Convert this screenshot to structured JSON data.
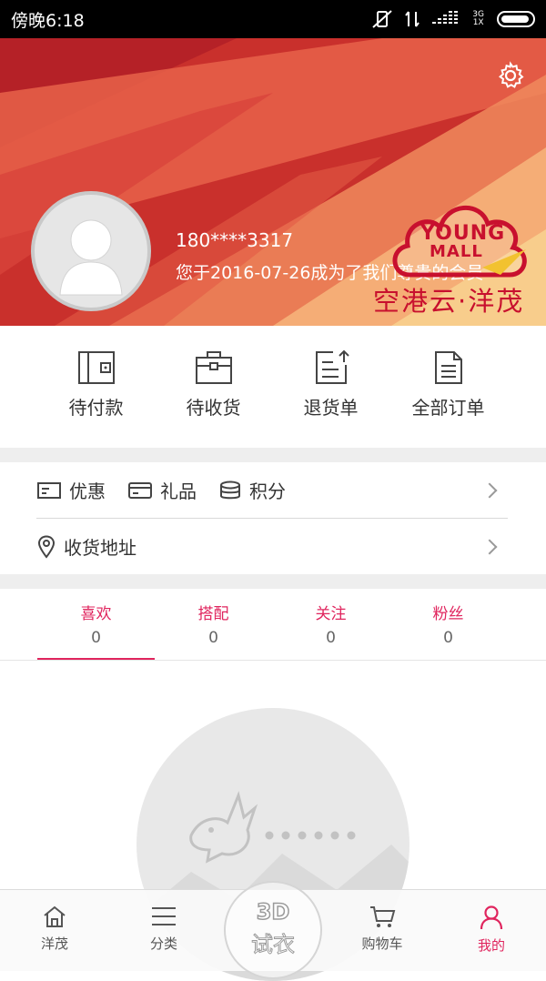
{
  "status_bar": {
    "time": "傍晚6:18",
    "network": "3G",
    "network_sub": "1X"
  },
  "profile": {
    "phone": "180****3317",
    "member_since": "您于2016-07-26成为了我们尊贵的会员"
  },
  "brand": {
    "logo_en_1": "YOUNG",
    "logo_en_2": "MALL",
    "logo_cn": "空港云·洋茂"
  },
  "orders": [
    {
      "label": "待付款",
      "icon": "wallet-icon"
    },
    {
      "label": "待收货",
      "icon": "briefcase-icon"
    },
    {
      "label": "退货单",
      "icon": "return-document-icon"
    },
    {
      "label": "全部订单",
      "icon": "document-icon"
    }
  ],
  "assets": [
    {
      "label": "优惠",
      "icon": "coupon-icon"
    },
    {
      "label": "礼品",
      "icon": "gift-card-icon"
    },
    {
      "label": "积分",
      "icon": "coins-icon"
    }
  ],
  "address": {
    "label": "收货地址",
    "icon": "location-pin-icon"
  },
  "social_tabs": [
    {
      "label": "喜欢",
      "count": "0",
      "active": true
    },
    {
      "label": "搭配",
      "count": "0",
      "active": false
    },
    {
      "label": "关注",
      "count": "0",
      "active": false
    },
    {
      "label": "粉丝",
      "count": "0",
      "active": false
    }
  ],
  "bottom_nav": [
    {
      "label": "洋茂",
      "icon": "home-icon"
    },
    {
      "label": "分类",
      "icon": "menu-icon"
    },
    {
      "label": "",
      "icon": ""
    },
    {
      "label": "购物车",
      "icon": "cart-icon"
    },
    {
      "label": "我的",
      "icon": "user-icon",
      "active": true
    }
  ],
  "try_on": {
    "badge": "3D",
    "label": "试衣"
  },
  "colors": {
    "accent": "#e0255e",
    "banner": "#d9413a"
  }
}
